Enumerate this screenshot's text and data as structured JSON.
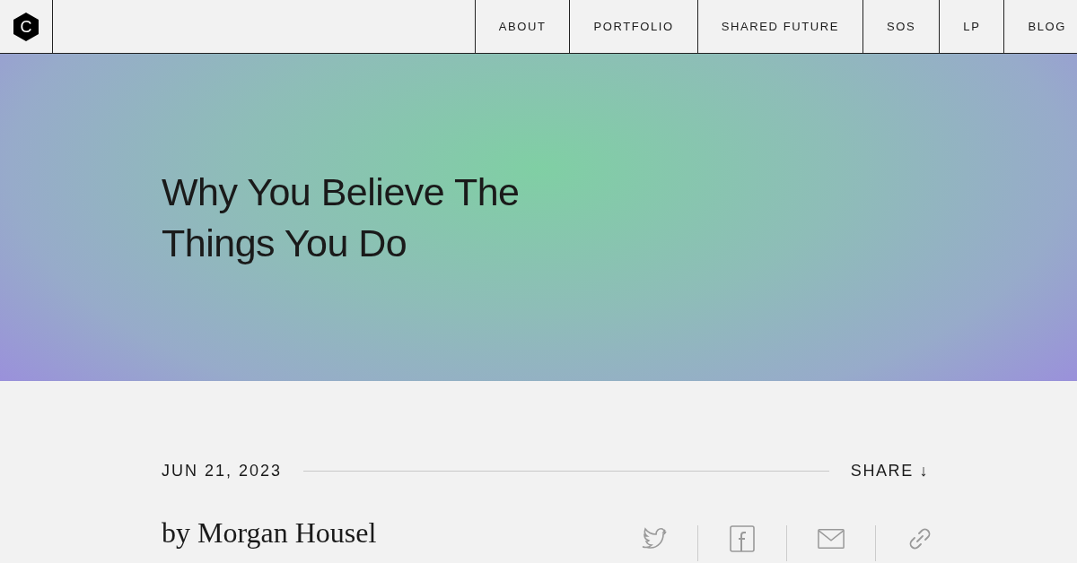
{
  "logo": {
    "letter": "C"
  },
  "nav": [
    {
      "label": "ABOUT"
    },
    {
      "label": "PORTFOLIO"
    },
    {
      "label": "SHARED FUTURE"
    },
    {
      "label": "SOS"
    },
    {
      "label": "LP"
    },
    {
      "label": "BLOG"
    }
  ],
  "hero": {
    "title": "Why You Believe The Things You Do"
  },
  "meta": {
    "date": "JUN 21, 2023",
    "share": "SHARE ↓"
  },
  "byline": "by Morgan Housel",
  "share_icons": [
    {
      "kind": "twitter"
    },
    {
      "kind": "facebook"
    },
    {
      "kind": "email"
    },
    {
      "kind": "link"
    }
  ]
}
